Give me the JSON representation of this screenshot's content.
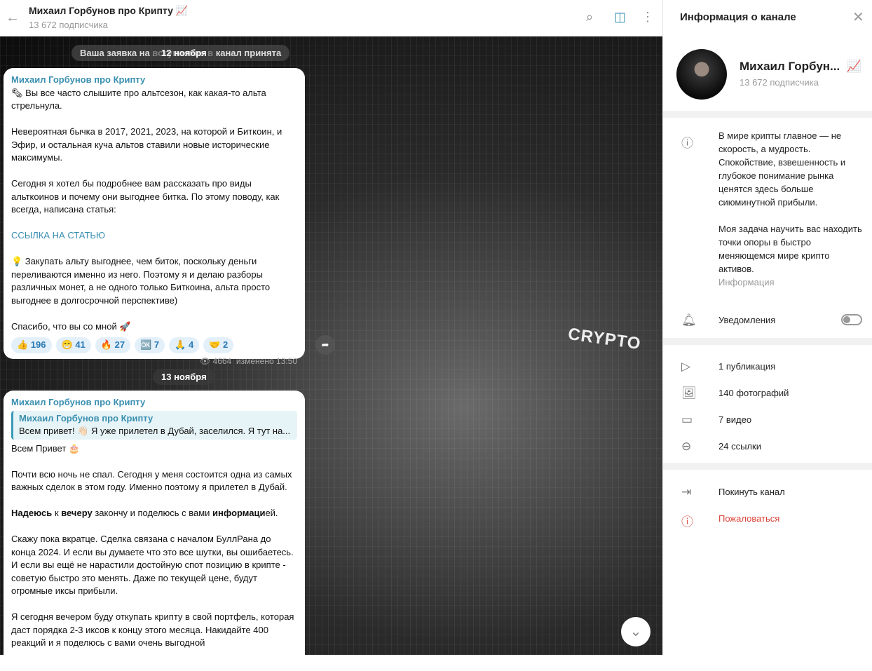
{
  "header": {
    "title": "Михаил Горбунов про Крипту 📈",
    "subscribers": "13 672 подписчика"
  },
  "chat": {
    "service_pill": "Ваша заявка на вступление в канал принята",
    "date1": "12 ноября",
    "date2": "13 ноября",
    "image_text": "CRYPTO",
    "msg1": {
      "author": "Михаил Горбунов про Крипту",
      "p1": "🗞 Вы все часто слышите про альтсезон, как какая-то альта стрельнула.",
      "p2": "Невероятная бычка в 2017, 2021, 2023, на которой и Биткоин, и Эфир, и остальная куча альтов ставили новые исторические максимумы.",
      "p3": "Сегодня я хотел бы подробнее вам рассказать про виды альткоинов и почему они выгоднее битка. По этому поводу, как всегда, написана статья:",
      "link": "ССЫЛКА НА СТАТЬЮ",
      "p4": "💡 Закупать альту выгоднее, чем биток, поскольку деньги переливаются именно из него. Поэтому я и делаю разборы различных монет, а не одного только Биткоина, альта просто выгоднее в долгосрочной перспективе)",
      "p5": "Спасибо, что вы со мной 🚀",
      "reactions": [
        {
          "emoji": "👍",
          "count": "196"
        },
        {
          "emoji": "😁",
          "count": "41"
        },
        {
          "emoji": "🔥",
          "count": "27"
        },
        {
          "emoji": "🆗",
          "count": "7"
        },
        {
          "emoji": "🙏",
          "count": "4"
        },
        {
          "emoji": "🤝",
          "count": "2"
        }
      ],
      "views": "4664",
      "edited": "изменено 13:50"
    },
    "msg2": {
      "author": "Михаил Горбунов про Крипту",
      "quote_author": "Михаил Горбунов про Крипту",
      "quote_text": "Всем привет! 👋🏻  Я уже прилетел в Дубай, заселился. Я тут на...",
      "p1": "Всем Привет 🎂",
      "p2": "Почти всю ночь не спал. Сегодня у меня состоится одна из самых важных сделок в этом году. Именно поэтому я прилетел в Дубай.",
      "p3": {
        "b1": "Надеюсь",
        "t1": " к ",
        "b2": "вечеру",
        "t2": " закончу и поделюсь с вами ",
        "b3": "информаци",
        "t3": "ей."
      },
      "p4": "Скажу пока вкратце. Сделка связана с началом БуллРана до конца 2024. И если вы думаете что это все шутки, вы ошибаетесь. И если вы ещё не нарастили достойную спот позицию в крипте - советую быстро это менять. Даже по текущей цене, будут огромные иксы прибыли.",
      "p5": "Я сегодня вечером буду откупать крипту в свой портфель, которая даст порядка 2-3 иксов к концу этого месяца. Накидайте 400 реакций и я поделюсь с вами очень выгодной"
    }
  },
  "side": {
    "title": "Информация о канале",
    "name": "Михаил Горбун...",
    "emoji": "📈",
    "subscribers": "13 672 подписчика",
    "description": "В мире крипты главное — не скорость, а мудрость. Спокойствие, взвешенность и глубокое понимание рынка ценятся здесь больше сиюминутной прибыли.",
    "description2": "Моя задача научить вас находить точки опоры в быстро меняющемся мире крипто активов.",
    "desc_label": "Информация",
    "notifications": "Уведомления",
    "notifications_on": false,
    "media": [
      "1 публикация",
      "140 фотографий",
      "7 видео",
      "24 ссылки"
    ],
    "leave": "Покинуть канал",
    "report": "Пожаловаться"
  },
  "colors": {
    "accent": "#3a8fb0",
    "danger": "#d9453b"
  }
}
